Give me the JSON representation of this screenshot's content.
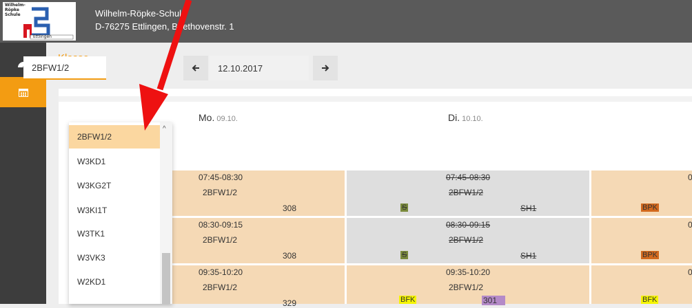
{
  "app": {
    "logo_text": [
      "Wilhelm-",
      "Röpke",
      "Schule",
      "Ettlingen"
    ],
    "school_name": "Wilhelm-Röpke-Schule",
    "school_address": "D-76275 Ettlingen, Beethovenstr. 1"
  },
  "sidebar": {
    "items": [
      {
        "icon": "dashboard-icon"
      },
      {
        "icon": "calendar-icon",
        "active": true
      }
    ]
  },
  "tab": {
    "label": "Klasse"
  },
  "filters": {
    "class_value": "2BFW1/2",
    "date_value": "12.10.2017",
    "prev_icon": "arrow-left-icon",
    "next_icon": "arrow-right-icon"
  },
  "dropdown": {
    "items": [
      "2BFW1/2",
      "W3KD1",
      "W3KG2T",
      "W3KI1T",
      "W3TK1",
      "W3VK3",
      "W2KD1"
    ],
    "selected_index": 0
  },
  "days": [
    {
      "name": "Mo.",
      "date": "09.10."
    },
    {
      "name": "Di.",
      "date": "10.10."
    }
  ],
  "timetable": {
    "monday": [
      {
        "time": "07:45-08:30",
        "class": "2BFW1/2",
        "room": "308"
      },
      {
        "time": "08:30-09:15",
        "class": "2BFW1/2",
        "room": "308"
      },
      {
        "time": "09:35-10:20",
        "class": "2BFW1/2",
        "room": "329"
      }
    ],
    "tuesday": [
      {
        "time": "07:45-08:30",
        "class": "2BFW1/2",
        "subject": "S",
        "room": "SH1",
        "cancelled": true
      },
      {
        "time": "08:30-09:15",
        "class": "2BFW1/2",
        "subject": "S",
        "room": "SH1",
        "cancelled": true
      },
      {
        "time": "09:35-10:20",
        "class": "2BFW1/2",
        "subject": "BFK",
        "room": "301",
        "cancelled": false
      }
    ],
    "wednesday": [
      {
        "time": "0",
        "subject": "BPK"
      },
      {
        "time": "0",
        "subject": "BPK"
      },
      {
        "time": "0",
        "subject": "BFK"
      }
    ]
  },
  "colors": {
    "accent": "#f39c12",
    "lesson_bg": "#f5d9b5",
    "cancelled_bg": "#dedede",
    "subject_s": "#7a8a3c",
    "subject_bpk": "#d2691e",
    "subject_bfk": "#f5f500",
    "room_301": "#b48ac8",
    "annotation_arrow": "#ee1111"
  }
}
